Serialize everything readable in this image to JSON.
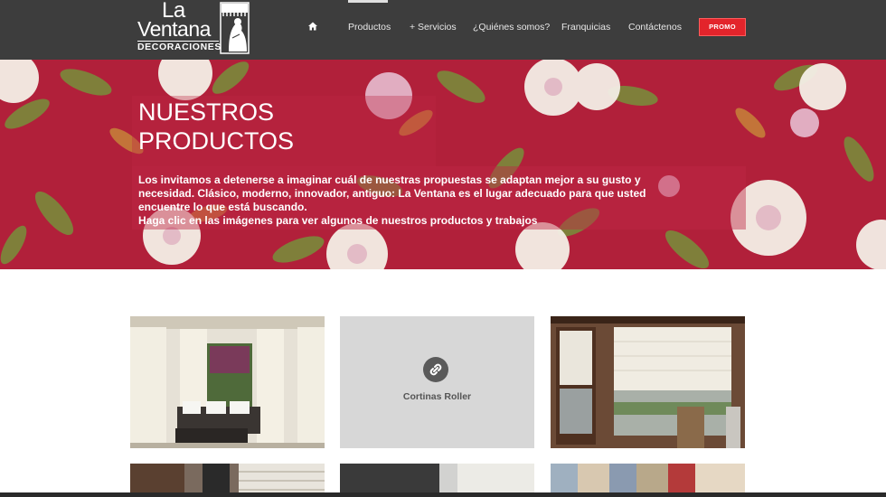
{
  "logo": {
    "line1": "La",
    "line2": "Ventana",
    "line3": "DECORACIONES"
  },
  "nav": {
    "home_icon": "home-icon",
    "items": [
      "Productos",
      "+ Servicios",
      "¿Quiénes somos?",
      "Franquicias",
      "Contáctenos"
    ],
    "active": "Productos",
    "promo_label": "PROMO"
  },
  "hero": {
    "title_line1": "NUESTROS",
    "title_line2": "PRODUCTOS",
    "text": "Los invitamos a detenerse a imaginar cuál de nuestras propuestas se adaptan mejor a su gusto y necesidad. Clásico, moderno, innovador, antiguo: La Ventana es el lugar adecuado para que usted encuentre lo que está buscando.",
    "text2": "Haga clic en las imágenes para ver algunos de nuestros productos y trabajos"
  },
  "products": {
    "hover_tile_caption": "Cortinas Roller",
    "link_icon": "link-icon"
  },
  "colors": {
    "header_bg": "#3d3d3d",
    "promo_red": "#e3242b",
    "hero_red": "#b1203a"
  }
}
